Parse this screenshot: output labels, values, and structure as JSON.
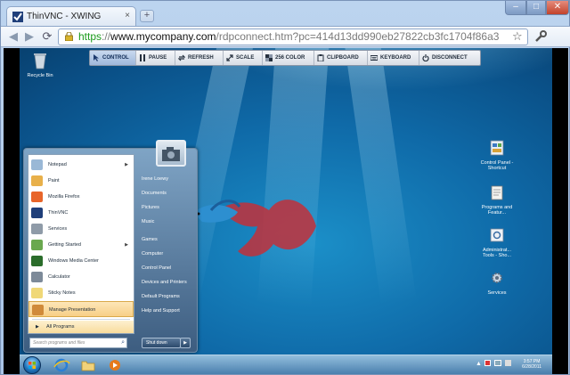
{
  "browser": {
    "tab_title": "ThinVNC - XWING",
    "new_tab_label": "+",
    "tab_close": "×",
    "window_buttons": {
      "minimize": "–",
      "maximize": "□",
      "close": "✕"
    }
  },
  "omnibox": {
    "scheme": "https",
    "host_sep": "://",
    "domain": "www.mycompany.com",
    "path": "/rdpconnect.htm?pc=414d13dd990eb27822cb3fc1704f86a3"
  },
  "toolbar": [
    {
      "label": "CONTROL",
      "icon": "cursor-icon",
      "active": true
    },
    {
      "label": "PAUSE",
      "icon": "pause-icon",
      "active": false
    },
    {
      "label": "REFRESH",
      "icon": "refresh-icon",
      "active": false
    },
    {
      "label": "SCALE",
      "icon": "scale-icon",
      "active": false
    },
    {
      "label": "256 COLOR",
      "icon": "palette-icon",
      "active": false
    },
    {
      "label": "CLIPBOARD",
      "icon": "clipboard-icon",
      "active": false
    },
    {
      "label": "KEYBOARD",
      "icon": "keyboard-icon",
      "active": false
    },
    {
      "label": "DISCONNECT",
      "icon": "power-icon",
      "active": false
    }
  ],
  "desktop_icons": {
    "recycle_bin": "Recycle Bin",
    "control_panel": "Control Panel - Shortcut",
    "programs": "Programs and Featur...",
    "admin_tools": "Administrat... Tools - Sho...",
    "services": "Services"
  },
  "start_menu": {
    "left_items": [
      {
        "label": "Notepad",
        "icon": "notepad-icon",
        "has_arrow": true,
        "highlight": false
      },
      {
        "label": "Paint",
        "icon": "paint-icon",
        "has_arrow": false,
        "highlight": false
      },
      {
        "label": "Mozilla Firefox",
        "icon": "firefox-icon",
        "has_arrow": false,
        "highlight": false
      },
      {
        "label": "ThinVNC",
        "icon": "thinvnc-icon",
        "has_arrow": false,
        "highlight": false
      },
      {
        "label": "Services",
        "icon": "services-icon",
        "has_arrow": false,
        "highlight": false
      },
      {
        "label": "Getting Started",
        "icon": "getting-started-icon",
        "has_arrow": true,
        "highlight": false
      },
      {
        "label": "Windows Media Center",
        "icon": "media-center-icon",
        "has_arrow": false,
        "highlight": false
      },
      {
        "label": "Calculator",
        "icon": "calculator-icon",
        "has_arrow": false,
        "highlight": false
      },
      {
        "label": "Sticky Notes",
        "icon": "sticky-notes-icon",
        "has_arrow": false,
        "highlight": false
      },
      {
        "label": "Manage Presentation",
        "icon": "presentation-icon",
        "has_arrow": false,
        "highlight": true
      }
    ],
    "all_programs": "All Programs",
    "search_placeholder": "Search programs and files",
    "right_items": [
      "Irene Loewy",
      "Documents",
      "Pictures",
      "Music",
      "Games",
      "Computer",
      "Control Panel",
      "Devices and Printers",
      "Default Programs",
      "Help and Support"
    ],
    "shutdown": "Shut down"
  },
  "taskbar": {
    "clock_time": "3:57 PM",
    "clock_date": "6/28/2011"
  },
  "colors": {
    "https_green": "#1a9a1a",
    "desktop_blue": "#0f6aa8",
    "highlight_orange": "#f7cf86"
  }
}
